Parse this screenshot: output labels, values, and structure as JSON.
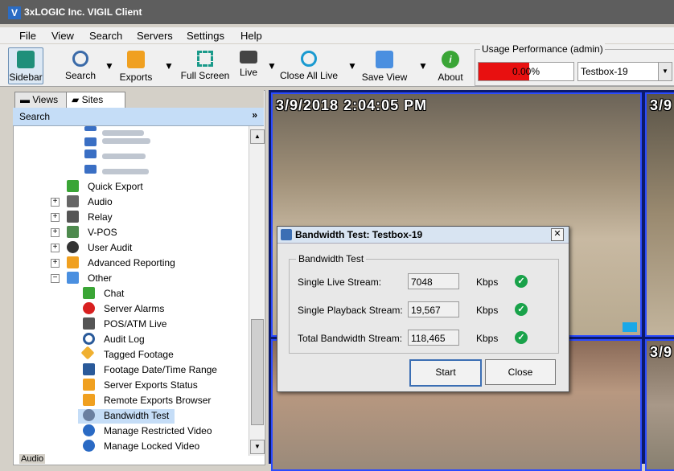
{
  "window": {
    "title": "3xLOGIC Inc. VIGIL Client",
    "app_icon_letter": "V"
  },
  "menu": [
    "File",
    "View",
    "Search",
    "Servers",
    "Settings",
    "Help"
  ],
  "toolbar": {
    "sidebar": "Sidebar",
    "search": "Search",
    "exports": "Exports",
    "full_screen": "Full Screen",
    "live": "Live",
    "close_all_live": "Close All Live",
    "save_view": "Save View",
    "about": "About"
  },
  "usage": {
    "legend": "Usage Performance (admin)",
    "percent_text": "0.00%",
    "server": "Testbox-19",
    "bar_color": "#e81010"
  },
  "left_panel": {
    "tabs": [
      "Views",
      "Sites"
    ],
    "search_header": "Search",
    "tree": [
      {
        "label": "Quick Export",
        "icon": "quick-export-icon"
      },
      {
        "label": "Audio",
        "icon": "audio-icon",
        "expand": "+"
      },
      {
        "label": "Relay",
        "icon": "relay-icon",
        "expand": "+"
      },
      {
        "label": "V-POS",
        "icon": "vpos-icon",
        "expand": "+"
      },
      {
        "label": "User Audit",
        "icon": "user-audit-icon",
        "expand": "+"
      },
      {
        "label": "Advanced Reporting",
        "icon": "reporting-icon",
        "expand": "+"
      },
      {
        "label": "Other",
        "icon": "other-icon",
        "expand": "−"
      },
      {
        "label": "Chat",
        "icon": "chat-icon"
      },
      {
        "label": "Server Alarms",
        "icon": "alarm-icon"
      },
      {
        "label": "POS/ATM Live",
        "icon": "pos-atm-icon"
      },
      {
        "label": "Audit Log",
        "icon": "audit-log-icon"
      },
      {
        "label": "Tagged Footage",
        "icon": "tag-icon"
      },
      {
        "label": "Footage Date/Time Range",
        "icon": "calendar-icon"
      },
      {
        "label": "Server Exports Status",
        "icon": "export-status-icon"
      },
      {
        "label": "Remote Exports Browser",
        "icon": "remote-export-icon"
      },
      {
        "label": "Bandwidth Test",
        "icon": "bandwidth-icon",
        "selected": true
      },
      {
        "label": "Manage Restricted Video",
        "icon": "restricted-video-icon"
      },
      {
        "label": "Manage Locked Video",
        "icon": "locked-video-icon"
      }
    ],
    "footer": "Audio"
  },
  "video": {
    "timestamp": "3/9/2018 2:04:05 PM",
    "timestamp_short": "3/9"
  },
  "dialog": {
    "title": "Bandwidth Test: Testbox-19",
    "group": "Bandwidth Test",
    "rows": [
      {
        "label": "Single Live Stream:",
        "value": "7048",
        "unit": "Kbps"
      },
      {
        "label": "Single Playback Stream:",
        "value": "19,567",
        "unit": "Kbps"
      },
      {
        "label": "Total Bandwidth Stream:",
        "value": "118,465",
        "unit": "Kbps"
      }
    ],
    "start": "Start",
    "close": "Close"
  }
}
